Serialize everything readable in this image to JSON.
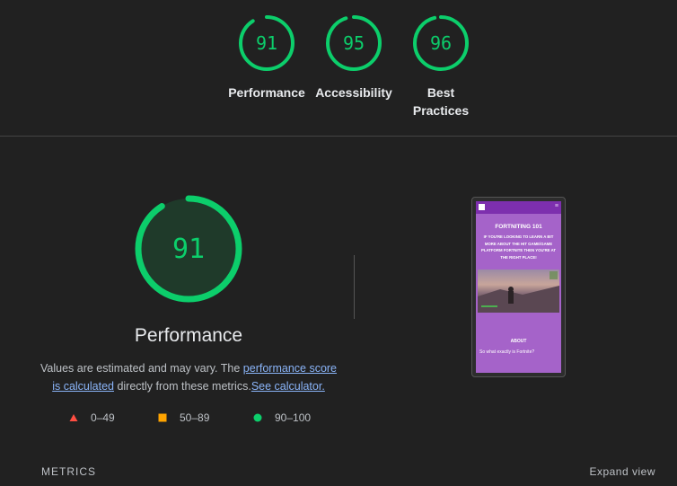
{
  "summary": {
    "items": [
      {
        "score": "91",
        "label": "Performance",
        "fraction": 0.91
      },
      {
        "score": "95",
        "label": "Accessibility",
        "fraction": 0.95
      },
      {
        "score": "96",
        "label_line1": "Best",
        "label_line2": "Practices",
        "fraction": 0.96
      }
    ]
  },
  "main": {
    "score": "91",
    "fraction": 0.91,
    "title": "Performance",
    "note_prefix": "Values are estimated and may vary. The ",
    "note_link1": "performance score is calculated",
    "note_mid": " directly from these metrics.",
    "note_link2": "See calculator."
  },
  "legend": [
    {
      "range": "0–49",
      "color": "#ff4e42",
      "shape": "triangle"
    },
    {
      "range": "50–89",
      "color": "#ffa400",
      "shape": "square"
    },
    {
      "range": "90–100",
      "color": "#0cce6b",
      "shape": "circle"
    }
  ],
  "screenshot": {
    "title": "FORTNITING 101",
    "subtitle": "IF YOU'RE LOOKING TO LEARN A BIT MORE ABOUT THE HIT GAME/GAME PLATFORM FORTNITE THEN YOU'RE AT THE RIGHT PLACE!",
    "about": "ABOUT",
    "question": "So what exactly is Fortnite?",
    "menu_icon": "≡"
  },
  "metrics": {
    "heading": "METRICS",
    "expand_label": "Expand view"
  },
  "colors": {
    "pass": "#0cce6b",
    "link": "#8ab4f8",
    "background": "#212121"
  }
}
